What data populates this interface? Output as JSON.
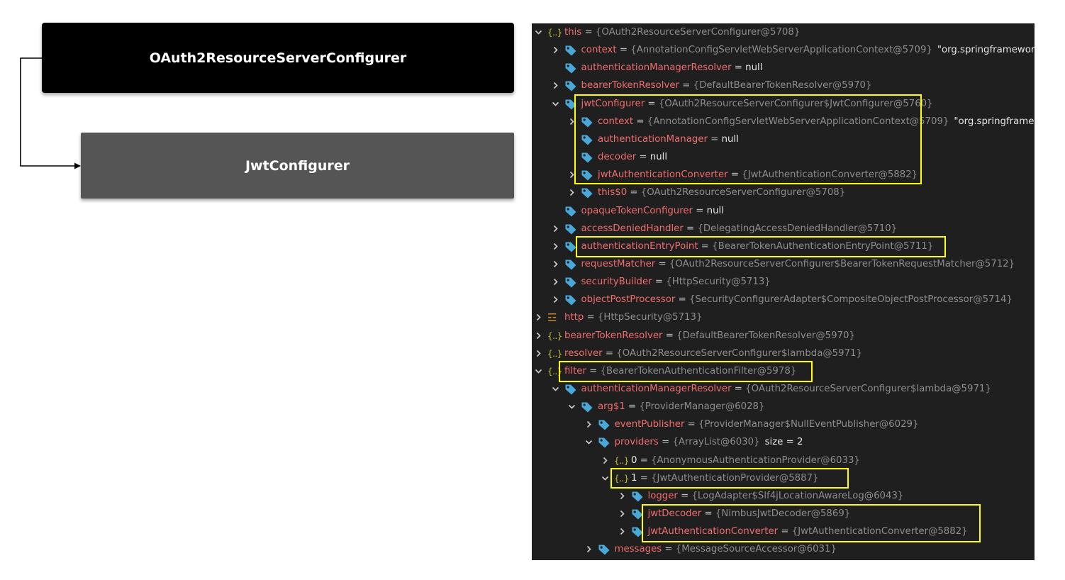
{
  "diagram": {
    "parent_label": "OAuth2ResourceServerConfigurer",
    "child_label": "JwtConfigurer"
  },
  "colors": {
    "field_name": "#f06d6d",
    "value": "#8d8d8d",
    "tag_icon": "#4aa8d8",
    "object_icon": "#c2c230",
    "highlight": "#ffff00",
    "panel_bg": "#1f1f1f"
  },
  "debugger": {
    "rows": [
      {
        "indent": 0,
        "expander": "down",
        "icon": "object-icon",
        "name": "this",
        "value": "{OAuth2ResourceServerConfigurer@5708}",
        "extra": ""
      },
      {
        "indent": 1,
        "expander": "right",
        "icon": "tag-icon",
        "name": "context",
        "value": "{AnnotationConfigServletWebServerApplicationContext@5709}",
        "extra": "\"org.springframework."
      },
      {
        "indent": 1,
        "expander": "none",
        "icon": "tag-icon",
        "name": "authenticationManagerResolver",
        "value": "null",
        "extra": ""
      },
      {
        "indent": 1,
        "expander": "right",
        "icon": "tag-icon",
        "name": "bearerTokenResolver",
        "value": "{DefaultBearerTokenResolver@5970}",
        "extra": ""
      },
      {
        "indent": 1,
        "expander": "down",
        "icon": "tag-icon",
        "name": "jwtConfigurer",
        "value": "{OAuth2ResourceServerConfigurer$JwtConfigurer@5760}",
        "extra": ""
      },
      {
        "indent": 2,
        "expander": "right",
        "icon": "tag-icon",
        "name": "context",
        "value": "{AnnotationConfigServletWebServerApplicationContext@5709}",
        "extra": "\"org.springframework."
      },
      {
        "indent": 2,
        "expander": "none",
        "icon": "tag-icon",
        "name": "authenticationManager",
        "value": "null",
        "extra": ""
      },
      {
        "indent": 2,
        "expander": "none",
        "icon": "tag-icon",
        "name": "decoder",
        "value": "null",
        "extra": ""
      },
      {
        "indent": 2,
        "expander": "right",
        "icon": "tag-icon",
        "name": "jwtAuthenticationConverter",
        "value": "{JwtAuthenticationConverter@5882}",
        "extra": ""
      },
      {
        "indent": 2,
        "expander": "right",
        "icon": "tag-icon",
        "name": "this$0",
        "value": "{OAuth2ResourceServerConfigurer@5708}",
        "extra": ""
      },
      {
        "indent": 1,
        "expander": "none",
        "icon": "tag-icon",
        "name": "opaqueTokenConfigurer",
        "value": "null",
        "extra": ""
      },
      {
        "indent": 1,
        "expander": "right",
        "icon": "tag-icon",
        "name": "accessDeniedHandler",
        "value": "{DelegatingAccessDeniedHandler@5710}",
        "extra": ""
      },
      {
        "indent": 1,
        "expander": "right",
        "icon": "tag-icon",
        "name": "authenticationEntryPoint",
        "value": "{BearerTokenAuthenticationEntryPoint@5711}",
        "extra": ""
      },
      {
        "indent": 1,
        "expander": "right",
        "icon": "tag-icon",
        "name": "requestMatcher",
        "value": "{OAuth2ResourceServerConfigurer$BearerTokenRequestMatcher@5712}",
        "extra": ""
      },
      {
        "indent": 1,
        "expander": "right",
        "icon": "tag-icon",
        "name": "securityBuilder",
        "value": "{HttpSecurity@5713}",
        "extra": ""
      },
      {
        "indent": 1,
        "expander": "right",
        "icon": "tag-icon",
        "name": "objectPostProcessor",
        "value": "{SecurityConfigurerAdapter$CompositeObjectPostProcessor@5714}",
        "extra": ""
      },
      {
        "indent": 0,
        "expander": "right",
        "icon": "http-icon",
        "name": "http",
        "value": "{HttpSecurity@5713}",
        "extra": ""
      },
      {
        "indent": 0,
        "expander": "right",
        "icon": "object-icon",
        "name": "bearerTokenResolver",
        "value": "{DefaultBearerTokenResolver@5970}",
        "extra": ""
      },
      {
        "indent": 0,
        "expander": "right",
        "icon": "object-icon",
        "name": "resolver",
        "value": "{OAuth2ResourceServerConfigurer$lambda@5971}",
        "extra": ""
      },
      {
        "indent": 0,
        "expander": "down",
        "icon": "object-icon",
        "name": "filter",
        "value": "{BearerTokenAuthenticationFilter@5978}",
        "extra": ""
      },
      {
        "indent": 1,
        "expander": "down",
        "icon": "tag-icon",
        "name": "authenticationManagerResolver",
        "value": "{OAuth2ResourceServerConfigurer$lambda@5971}",
        "extra": ""
      },
      {
        "indent": 2,
        "expander": "down",
        "icon": "tag-icon",
        "name": "arg$1",
        "value": "{ProviderManager@6028}",
        "extra": ""
      },
      {
        "indent": 3,
        "expander": "right",
        "icon": "tag-icon",
        "name": "eventPublisher",
        "value": "{ProviderManager$NullEventPublisher@6029}",
        "extra": ""
      },
      {
        "indent": 3,
        "expander": "down",
        "icon": "tag-icon",
        "name": "providers",
        "value": "{ArrayList@6030}",
        "extra": "size = 2"
      },
      {
        "indent": 4,
        "expander": "right",
        "icon": "object-icon",
        "name": "0",
        "value": "{AnonymousAuthenticationProvider@6033}",
        "extra": ""
      },
      {
        "indent": 4,
        "expander": "down",
        "icon": "object-icon",
        "name": "1",
        "value": "{JwtAuthenticationProvider@5887}",
        "extra": ""
      },
      {
        "indent": 5,
        "expander": "right",
        "icon": "tag-icon",
        "name": "logger",
        "value": "{LogAdapter$Slf4jLocationAwareLog@6043}",
        "extra": ""
      },
      {
        "indent": 5,
        "expander": "right",
        "icon": "tag-icon",
        "name": "jwtDecoder",
        "value": "{NimbusJwtDecoder@5869}",
        "extra": ""
      },
      {
        "indent": 5,
        "expander": "right",
        "icon": "tag-icon",
        "name": "jwtAuthenticationConverter",
        "value": "{JwtAuthenticationConverter@5882}",
        "extra": ""
      },
      {
        "indent": 3,
        "expander": "right",
        "icon": "tag-icon",
        "name": "messages",
        "value": "{MessageSourceAccessor@6031}",
        "extra": ""
      }
    ]
  }
}
